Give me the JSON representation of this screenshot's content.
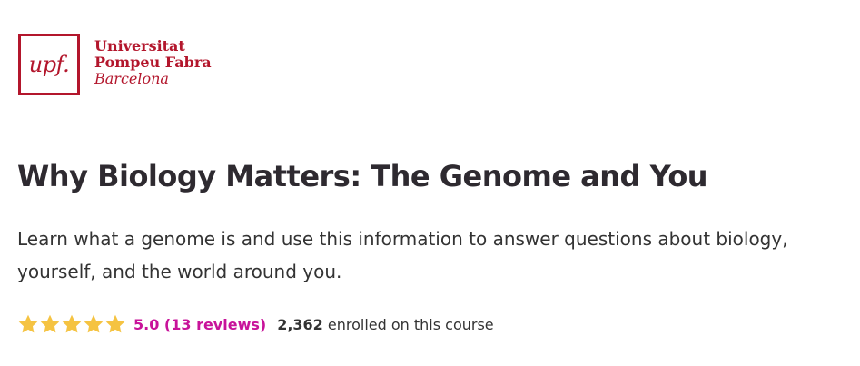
{
  "logo": {
    "monogram": "upf.",
    "line1": "Universitat",
    "line2": "Pompeu Fabra",
    "line3": "Barcelona",
    "color": "#b3162c"
  },
  "course": {
    "title": "Why Biology Matters: The Genome and You",
    "description": "Learn what a genome is and use this information to answer questions about biology, yourself, and the world around you."
  },
  "rating": {
    "stars": 5,
    "star_icon": "star-icon",
    "star_color": "#f5c342",
    "link_text": "5.0 (13 reviews)",
    "link_color": "#c8139a",
    "enrolled_count": "2,362",
    "enrolled_text": "enrolled on this course"
  }
}
